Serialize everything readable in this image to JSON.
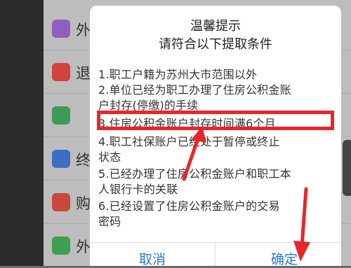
{
  "background_list": {
    "items": [
      {
        "label": "外",
        "icon": "purple-user-icon",
        "color": "#8e5fc0"
      },
      {
        "label": "退",
        "icon": "red-user-icon",
        "color": "#d0443b"
      },
      {
        "label": "",
        "icon": "green-document-icon",
        "color": "#3d9b5a"
      },
      {
        "label": "终",
        "icon": "blue-list-icon",
        "color": "#3b6fc6"
      },
      {
        "label": "购",
        "icon": "red-document-icon",
        "color": "#c8473e"
      },
      {
        "label": "外",
        "icon": "green-check-document-icon",
        "color": "#3f9e4f"
      }
    ]
  },
  "dialog": {
    "title": "温馨提示",
    "subtitle": "请符合以下提取条件",
    "conditions": [
      "1.职工户籍为苏州大市范围以外",
      "2.单位已经为职工办理了住房公积金账",
      "户封存(停缴)的手续",
      "3.住房公积金账户封存时间满6个月",
      "4.职工社保账户已经处于暂停或终止",
      "状态",
      "5.已经办理了住房公积金账户和职工本",
      "人银行卡的关联",
      "6.已经设置了住房公积金账户的交易",
      "密码"
    ],
    "cancel_label": "取消",
    "confirm_label": "确定"
  },
  "annotation": {
    "highlight_color": "#e8262a"
  }
}
